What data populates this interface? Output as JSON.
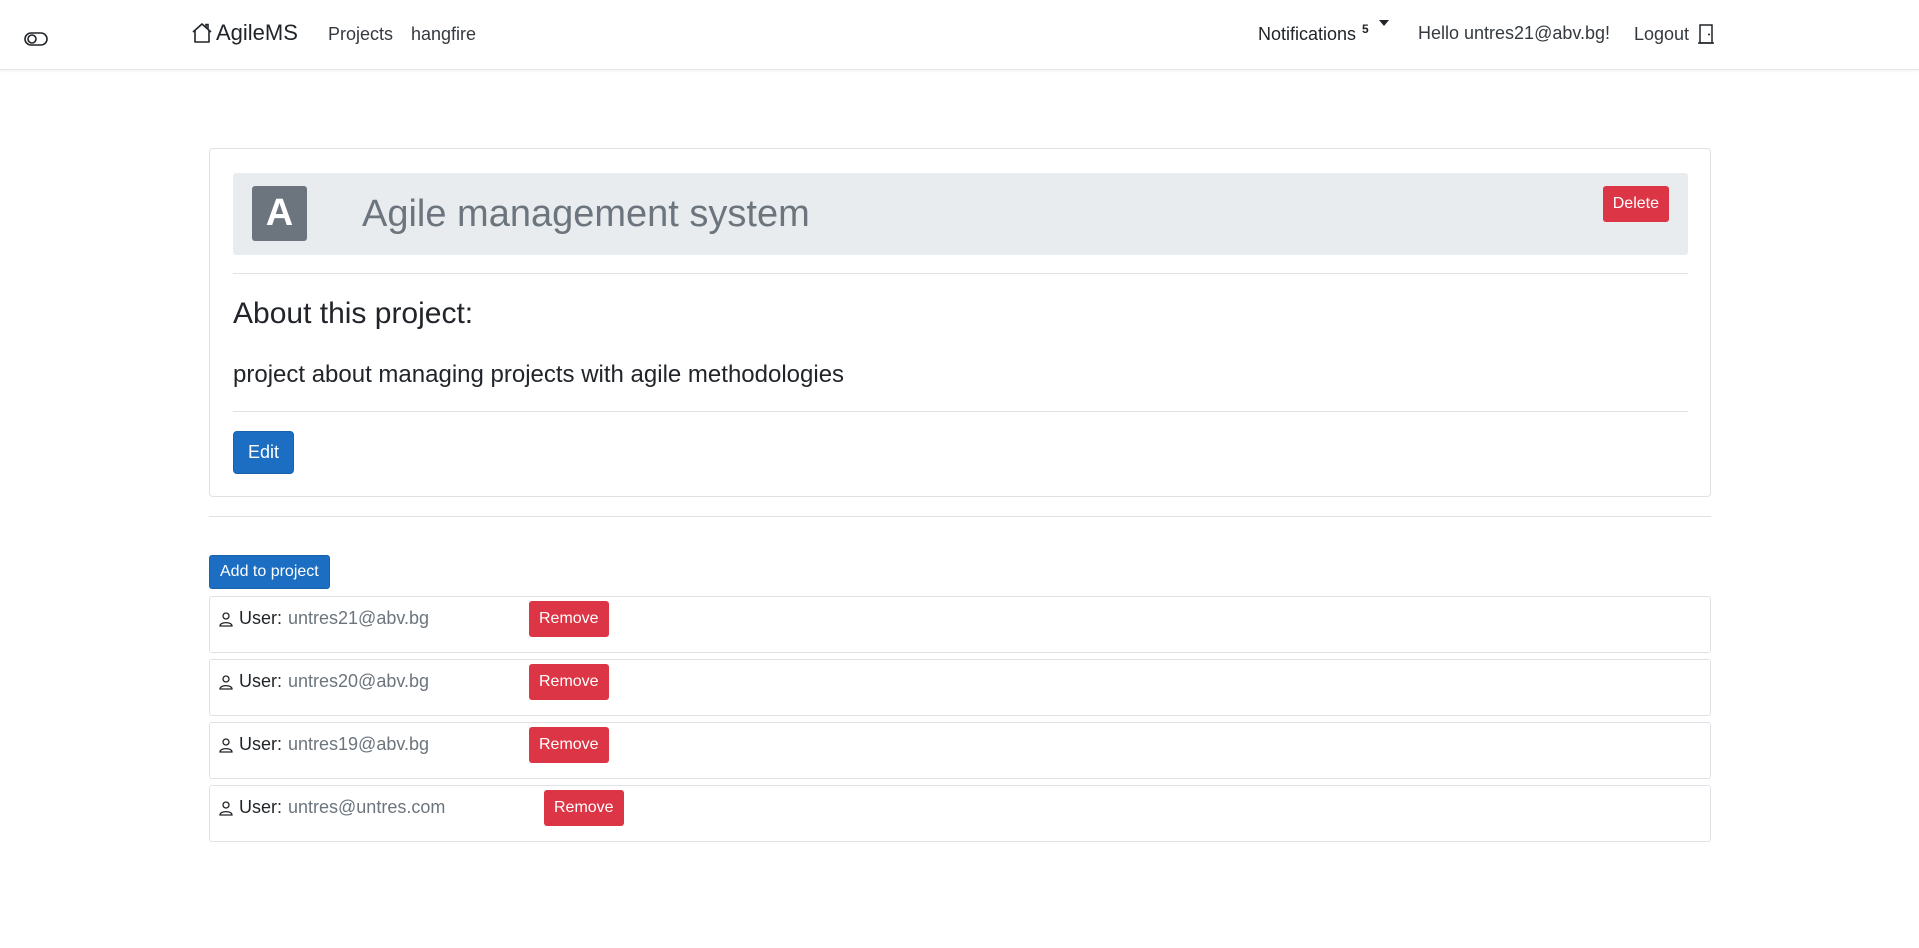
{
  "navbar": {
    "brand": "AgileMS",
    "projects": "Projects",
    "hangfire": "hangfire",
    "notifications": "Notifications",
    "notification_count": "5",
    "greeting": "Hello untres21@abv.bg!",
    "logout": "Logout"
  },
  "project": {
    "avatar_letter": "A",
    "title": "Agile management system",
    "delete_label": "Delete",
    "about_heading": "About this project:",
    "description": "project about managing projects with agile methodologies",
    "edit_label": "Edit"
  },
  "members": {
    "add_label": "Add to project",
    "user_label": "User:",
    "remove_label": "Remove",
    "list": [
      {
        "email": "untres21@abv.bg"
      },
      {
        "email": "untres20@abv.bg"
      },
      {
        "email": "untres19@abv.bg"
      },
      {
        "email": "untres@untres.com"
      }
    ]
  },
  "colors": {
    "primary": "#1b6ec2",
    "danger": "#dc3545",
    "secondary": "#6c757d",
    "header_bg": "#e9ecef"
  }
}
